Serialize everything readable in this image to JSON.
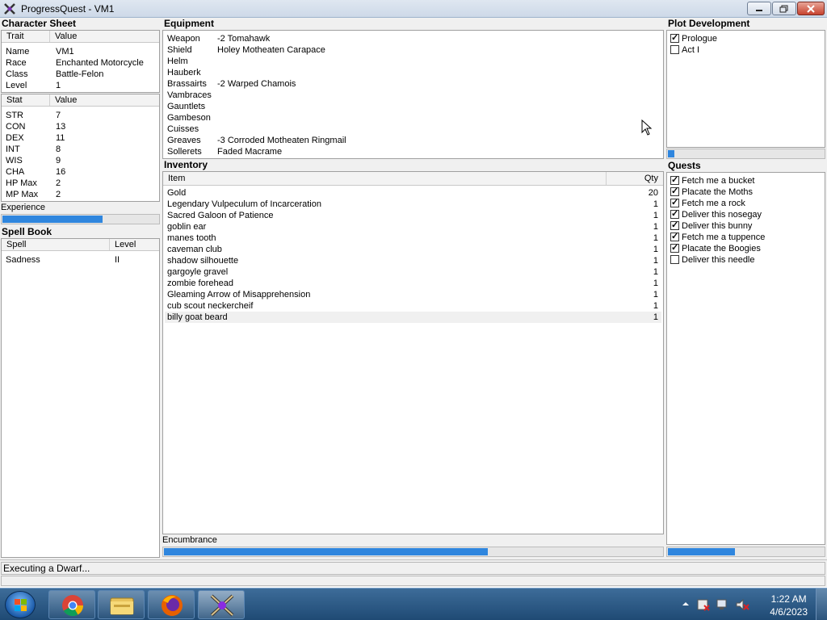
{
  "window": {
    "title": "ProgressQuest - VM1"
  },
  "character_sheet": {
    "title": "Character Sheet",
    "traits_header": {
      "col1": "Trait",
      "col2": "Value"
    },
    "traits": [
      {
        "k": "Name",
        "v": "VM1"
      },
      {
        "k": "Race",
        "v": "Enchanted Motorcycle"
      },
      {
        "k": "Class",
        "v": "Battle-Felon"
      },
      {
        "k": "Level",
        "v": "1"
      }
    ],
    "stats_header": {
      "col1": "Stat",
      "col2": "Value"
    },
    "stats": [
      {
        "k": "STR",
        "v": "7"
      },
      {
        "k": "CON",
        "v": "13"
      },
      {
        "k": "DEX",
        "v": "11"
      },
      {
        "k": "INT",
        "v": "8"
      },
      {
        "k": "WIS",
        "v": "9"
      },
      {
        "k": "CHA",
        "v": "16"
      },
      {
        "k": "HP Max",
        "v": "2"
      },
      {
        "k": "MP Max",
        "v": "2"
      }
    ],
    "experience_label": "Experience",
    "experience_progress": 0.64
  },
  "spell_book": {
    "title": "Spell Book",
    "header": {
      "col1": "Spell",
      "col2": "Level"
    },
    "spells": [
      {
        "name": "Sadness",
        "level": "II"
      }
    ]
  },
  "equipment": {
    "title": "Equipment",
    "items": [
      {
        "slot": "Weapon",
        "item": "-2 Tomahawk"
      },
      {
        "slot": "Shield",
        "item": "Holey Motheaten Carapace"
      },
      {
        "slot": "Helm",
        "item": ""
      },
      {
        "slot": "Hauberk",
        "item": ""
      },
      {
        "slot": "Brassairts",
        "item": "-2 Warped Chamois"
      },
      {
        "slot": "Vambraces",
        "item": ""
      },
      {
        "slot": "Gauntlets",
        "item": ""
      },
      {
        "slot": "Gambeson",
        "item": ""
      },
      {
        "slot": "Cuisses",
        "item": ""
      },
      {
        "slot": "Greaves",
        "item": "-3 Corroded Motheaten Ringmail"
      },
      {
        "slot": "Sollerets",
        "item": "Faded Macrame"
      }
    ]
  },
  "inventory": {
    "title": "Inventory",
    "header": {
      "item": "Item",
      "qty": "Qty"
    },
    "items": [
      {
        "name": "Gold",
        "qty": "20"
      },
      {
        "name": "Legendary Vulpeculum of Incarceration",
        "qty": "1"
      },
      {
        "name": "Sacred Galoon of Patience",
        "qty": "1"
      },
      {
        "name": "goblin ear",
        "qty": "1"
      },
      {
        "name": "manes tooth",
        "qty": "1"
      },
      {
        "name": "caveman club",
        "qty": "1"
      },
      {
        "name": "shadow silhouette",
        "qty": "1"
      },
      {
        "name": "gargoyle gravel",
        "qty": "1"
      },
      {
        "name": "zombie forehead",
        "qty": "1"
      },
      {
        "name": "Gleaming Arrow of Misapprehension",
        "qty": "1"
      },
      {
        "name": "cub scout neckercheif",
        "qty": "1"
      },
      {
        "name": "billy goat beard",
        "qty": "1"
      }
    ],
    "encumbrance_label": "Encumbrance",
    "encumbrance_progress": 0.65
  },
  "plot": {
    "title": "Plot Development",
    "acts": [
      {
        "label": "Prologue",
        "checked": true
      },
      {
        "label": "Act I",
        "checked": false
      }
    ],
    "progress": 0.04
  },
  "quests": {
    "title": "Quests",
    "items": [
      {
        "label": "Fetch me a bucket",
        "checked": true
      },
      {
        "label": "Placate the Moths",
        "checked": true
      },
      {
        "label": "Fetch me a rock",
        "checked": true
      },
      {
        "label": "Deliver this nosegay",
        "checked": true
      },
      {
        "label": "Deliver this bunny",
        "checked": true
      },
      {
        "label": "Fetch me a tuppence",
        "checked": true
      },
      {
        "label": "Placate the Boogies",
        "checked": true
      },
      {
        "label": "Deliver this needle",
        "checked": false
      }
    ],
    "progress": 0.43
  },
  "status": {
    "text": "Executing a Dwarf..."
  },
  "taskbar": {
    "apps": [
      "chrome-icon",
      "file-explorer-icon",
      "firefox-icon",
      "progressquest-icon"
    ],
    "time": "1:22 AM",
    "date": "4/6/2023"
  }
}
